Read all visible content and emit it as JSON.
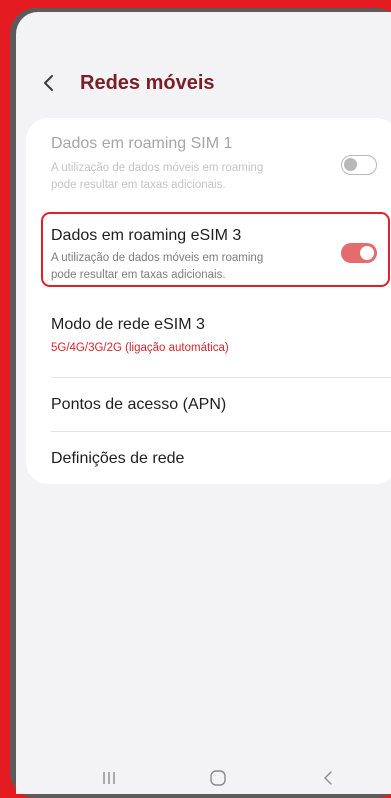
{
  "header": {
    "title": "Redes móveis"
  },
  "settings": {
    "roaming_sim1": {
      "title": "Dados em roaming SIM 1",
      "sub1": "A utilização de dados móveis em roaming",
      "sub2": "pode resultar em taxas adicionais.",
      "toggle": "off",
      "enabled": false
    },
    "roaming_esim3": {
      "title": "Dados em roaming eSIM 3",
      "sub1": "A utilização de dados móveis em roaming",
      "sub2": "pode resultar em taxas adicionais.",
      "toggle": "on",
      "enabled": true
    },
    "network_mode": {
      "title": "Modo de rede eSIM 3",
      "value": "5G/4G/3G/2G (ligação automática)"
    },
    "apn": {
      "title": "Pontos de acesso (APN)"
    },
    "network_settings": {
      "title": "Definições de rede"
    }
  },
  "icons": {
    "back": "chevron-left-icon",
    "recents": "recent-apps-icon",
    "home": "home-icon",
    "nav_back": "back-icon"
  },
  "colors": {
    "background_frame": "#e41c22",
    "title": "#7a1f27",
    "accent_red": "#d7242b",
    "toggle_on": "#e46b6e",
    "highlight_border": "#e0202a"
  }
}
